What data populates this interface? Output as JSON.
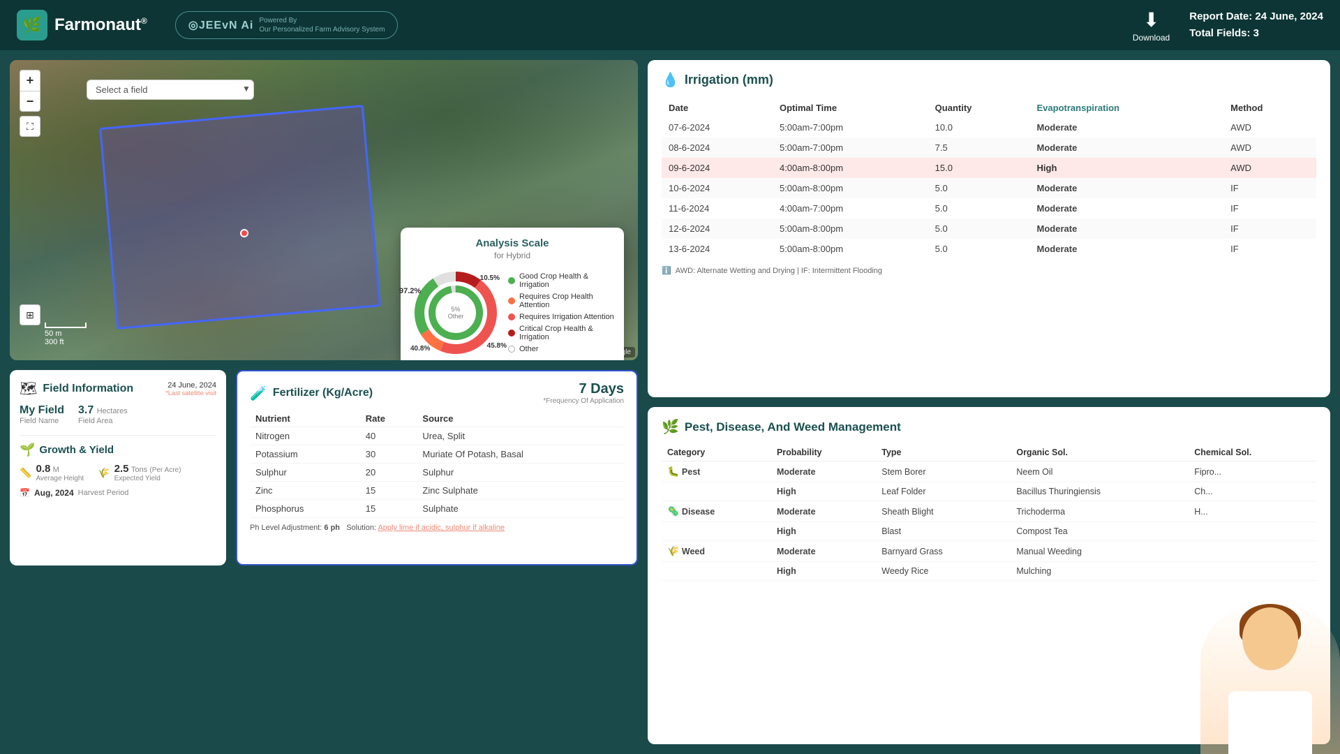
{
  "header": {
    "logo_text": "Farmonaut",
    "logo_superscript": "®",
    "jeevn_logo": "◎JEEvN Ai",
    "powered_by": "Powered By",
    "advisory": "Our Personalized Farm Advisory System",
    "download_label": "Download",
    "report_date_label": "Report Date:",
    "report_date": "24 June, 2024",
    "total_fields_label": "Total Fields:",
    "total_fields": "3"
  },
  "map": {
    "select_placeholder": "Select a field",
    "zoom_in": "+",
    "zoom_out": "−",
    "scale_m": "50 m",
    "scale_ft": "300 ft",
    "attribution": "Leaflet | © OpenStreetMap contributors, Google"
  },
  "analysis_scale": {
    "title": "Analysis Scale",
    "subtitle": "for Hybrid",
    "pct_good": "97.2%",
    "pct_requires_crop": "10.5%",
    "pct_requires_irr": "45.8%",
    "pct_other": "40.8%",
    "center_5pct": "5%",
    "center_other": "Other",
    "legend": [
      {
        "color": "#4caf50",
        "label": "Good Crop Health & Irrigation"
      },
      {
        "color": "#ff7043",
        "label": "Requires Crop Health Attention"
      },
      {
        "color": "#ef5350",
        "label": "Requires Irrigation Attention"
      },
      {
        "color": "#b71c1c",
        "label": "Critical Crop Health & Irrigation"
      },
      {
        "color": "transparent",
        "label": "Other",
        "border": "#aaa"
      }
    ]
  },
  "irrigation": {
    "title": "Irrigation (mm)",
    "icon": "💧",
    "columns": [
      "Date",
      "Optimal Time",
      "Quantity",
      "Evapotranspiration",
      "Method"
    ],
    "rows": [
      {
        "date": "07-6-2024",
        "time": "5:00am-7:00pm",
        "qty": "10.0",
        "evap": "Moderate",
        "method": "AWD",
        "highlight": false
      },
      {
        "date": "08-6-2024",
        "time": "5:00am-7:00pm",
        "qty": "7.5",
        "evap": "Moderate",
        "method": "AWD",
        "highlight": false
      },
      {
        "date": "09-6-2024",
        "time": "4:00am-8:00pm",
        "qty": "15.0",
        "evap": "High",
        "method": "AWD",
        "highlight": true
      },
      {
        "date": "10-6-2024",
        "time": "5:00am-8:00pm",
        "qty": "5.0",
        "evap": "Moderate",
        "method": "IF",
        "highlight": false
      },
      {
        "date": "11-6-2024",
        "time": "4:00am-7:00pm",
        "qty": "5.0",
        "evap": "Moderate",
        "method": "IF",
        "highlight": false
      },
      {
        "date": "12-6-2024",
        "time": "5:00am-8:00pm",
        "qty": "5.0",
        "evap": "Moderate",
        "method": "IF",
        "highlight": false
      },
      {
        "date": "13-6-2024",
        "time": "5:00am-8:00pm",
        "qty": "5.0",
        "evap": "Moderate",
        "method": "IF",
        "highlight": false
      }
    ],
    "footnote": "AWD: Alternate Wetting and Drying | IF: Intermittent Flooding"
  },
  "field_info": {
    "title": "Field Information",
    "icon": "🗺",
    "date": "24 June, 2024",
    "date_note": "*Last satellite visit",
    "field_name_label": "Field Name",
    "field_name_value": "My Field",
    "area_label": "Field Area",
    "area_value": "3.7",
    "area_unit": "Hectares",
    "growth_title": "Growth & Yield",
    "growth_icon": "🌱",
    "height_label": "Average Height",
    "height_value": "0.8",
    "height_unit": "M",
    "yield_label": "Expected Yield",
    "yield_value": "2.5",
    "yield_unit": "Tons",
    "yield_per": "(Per Acre)",
    "harvest_label": "Harvest Period",
    "harvest_value": "Aug, 2024"
  },
  "fertilizer": {
    "title": "Fertilizer (Kg/Acre)",
    "icon": "🧪",
    "days": "7 Days",
    "freq_label": "*Frequency Of Application",
    "columns": [
      "Nutrient",
      "Rate",
      "Source"
    ],
    "rows": [
      {
        "nutrient": "Nitrogen",
        "rate": "40",
        "source": "Urea, Split"
      },
      {
        "nutrient": "Potassium",
        "rate": "30",
        "source": "Muriate Of Potash, Basal"
      },
      {
        "nutrient": "Sulphur",
        "rate": "20",
        "source": "Sulphur"
      },
      {
        "nutrient": "Zinc",
        "rate": "15",
        "source": "Zinc Sulphate"
      },
      {
        "nutrient": "Phosphorus",
        "rate": "15",
        "source": "Sulphate"
      }
    ],
    "ph_label": "Ph Level Adjustment:",
    "ph_value": "6 ph",
    "solution_label": "Solution:",
    "solution_text": "Apply lime if acidic, sulphur if alkaline"
  },
  "pest": {
    "title": "Pest, Disease, And Weed Management",
    "icon": "🌿",
    "columns": [
      "Category",
      "Probability",
      "Type",
      "Organic Sol.",
      "Chemical Sol."
    ],
    "rows": [
      {
        "category": "Pest",
        "cat_icon": "🐛",
        "prob": "Moderate",
        "prob_color": "moderate",
        "type": "Stem Borer",
        "organic": "Neem Oil",
        "chemical": "Fipro..."
      },
      {
        "category": "",
        "cat_icon": "",
        "prob": "High",
        "prob_color": "high",
        "type": "Leaf Folder",
        "organic": "Bacillus Thuringiensis",
        "chemical": "Ch..."
      },
      {
        "category": "Disease",
        "cat_icon": "🦠",
        "prob": "Moderate",
        "prob_color": "moderate",
        "type": "Sheath Blight",
        "organic": "Trichoderma",
        "chemical": "H..."
      },
      {
        "category": "",
        "cat_icon": "",
        "prob": "High",
        "prob_color": "high",
        "type": "Blast",
        "organic": "Compost Tea",
        "chemical": ""
      },
      {
        "category": "Weed",
        "cat_icon": "🌾",
        "prob": "Moderate",
        "prob_color": "moderate",
        "type": "Barnyard Grass",
        "organic": "Manual Weeding",
        "chemical": ""
      },
      {
        "category": "",
        "cat_icon": "",
        "prob": "High",
        "prob_color": "high",
        "type": "Weedy Rice",
        "organic": "Mulching",
        "chemical": ""
      }
    ]
  }
}
